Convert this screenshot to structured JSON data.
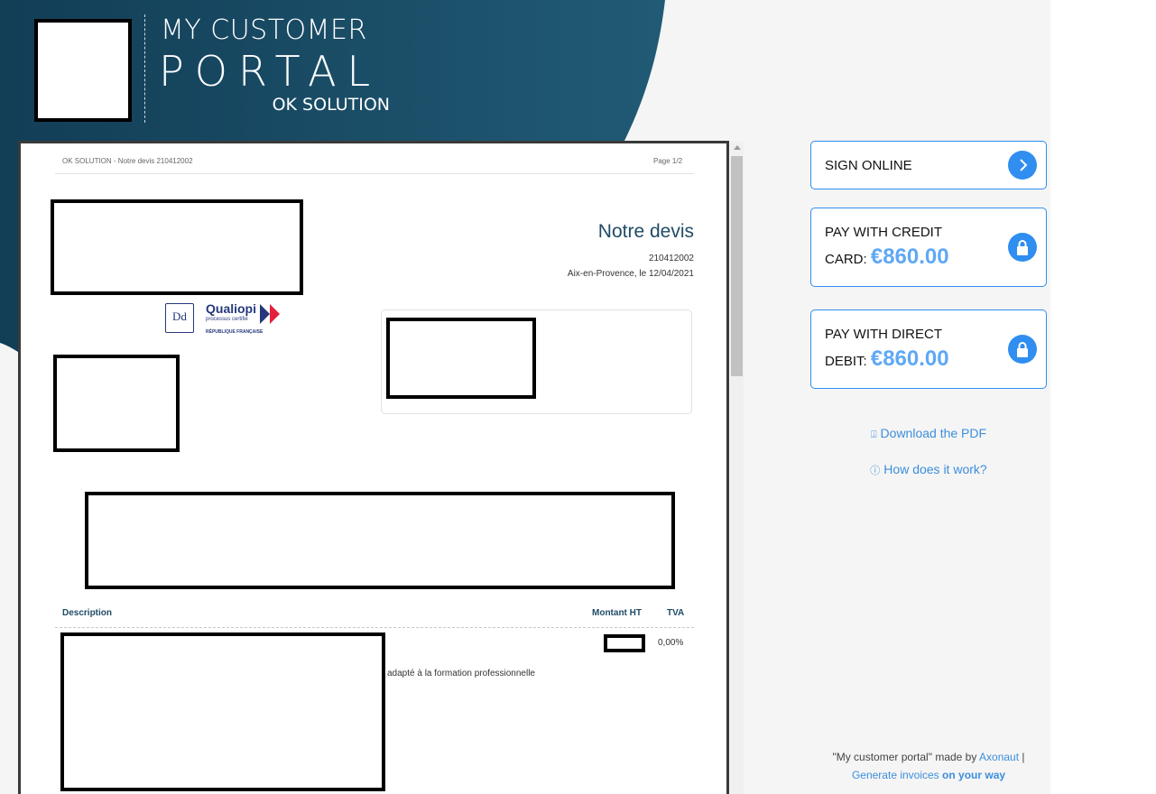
{
  "header": {
    "line1": "MY CUSTOMER",
    "line2": "PORTAL",
    "line3": "OK SOLUTION"
  },
  "document": {
    "header_left": "OK SOLUTION - Notre devis 210412002",
    "header_right": "Page 1/2",
    "title": "Notre devis",
    "number": "210412002",
    "place_date": "Aix-en-Provence, le 12/04/2021",
    "certifications": {
      "dd_logo": "Dd",
      "qualiopi": "Qualiopi",
      "qualiopi_sub": "processus certifié",
      "qualiopi_rep": "RÉPUBLIQUE FRANÇAISE"
    },
    "table": {
      "headers": [
        "Description",
        "Montant HT",
        "TVA"
      ],
      "rows": [
        {
          "description_suffix": "adapté à la formation professionnelle",
          "tva": "0,00%"
        }
      ]
    }
  },
  "actions": {
    "sign": {
      "label": "SIGN ONLINE",
      "icon": "chevron-right-icon"
    },
    "card": {
      "line1": "PAY WITH CREDIT",
      "line2_prefix": "CARD:",
      "amount": "€860.00",
      "icon": "lock-icon"
    },
    "debit": {
      "line1": "PAY WITH DIRECT",
      "line2_prefix": "DEBIT:",
      "amount": "€860.00",
      "icon": "lock-icon"
    }
  },
  "links": {
    "download": "Download the PDF",
    "help": "How does it work?"
  },
  "footer": {
    "made_by_prefix": "\"My customer portal\" made by",
    "brand_link": "Axonaut",
    "separator": "|",
    "generate_prefix": "Generate invoices",
    "generate_bold": "on your way"
  },
  "colors": {
    "header_dark": "#14455e",
    "accent_blue": "#2f8ef0",
    "amount_blue": "#5fa8f5",
    "doc_title": "#1f4b67"
  }
}
